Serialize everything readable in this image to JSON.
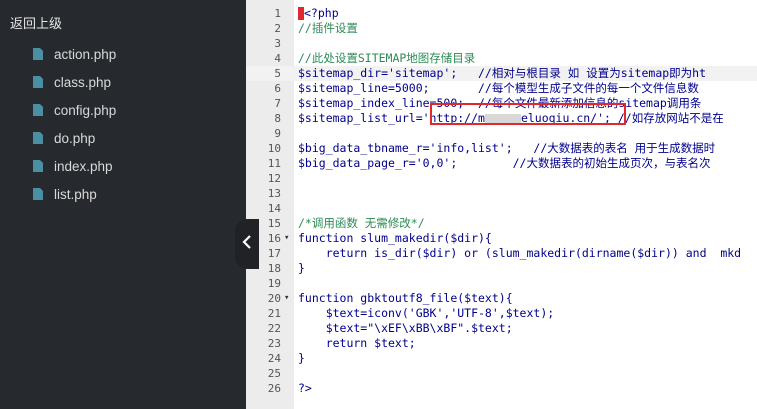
{
  "sidebar": {
    "back_label": "返回上级",
    "files": [
      {
        "name": "action.php"
      },
      {
        "name": "class.php"
      },
      {
        "name": "config.php"
      },
      {
        "name": "do.php"
      },
      {
        "name": "index.php"
      },
      {
        "name": "list.php"
      }
    ]
  },
  "editor": {
    "lines": [
      {
        "n": "1",
        "text": "<?php"
      },
      {
        "n": "2",
        "text": "//插件设置"
      },
      {
        "n": "3",
        "text": ""
      },
      {
        "n": "4",
        "text": "//此处设置SITEMAP地图存储目录"
      },
      {
        "n": "5",
        "text": "$sitemap_dir='sitemap';   //相对与根目录 如 设置为sitemap即为ht"
      },
      {
        "n": "6",
        "text": "$sitemap_line=5000;       //每个模型生成子文件的每一个文件信息数"
      },
      {
        "n": "7",
        "text": "$sitemap_index_line=500;  //每个文件最新添加信息的sitemap调用条"
      },
      {
        "n": "8a",
        "text": "$sitemap_list_url='http://m"
      },
      {
        "n": "8b",
        "text": "eluoqiu.cn/'; //如存放网站不是在"
      },
      {
        "n": "9",
        "text": ""
      },
      {
        "n": "10",
        "text": "$big_data_tbname_r='info,list';   //大数据表的表名 用于生成数据时"
      },
      {
        "n": "11",
        "text": "$big_data_page_r='0,0';        //大数据表的初始生成页次，与表名次"
      },
      {
        "n": "12",
        "text": ""
      },
      {
        "n": "13",
        "text": ""
      },
      {
        "n": "14",
        "text": ""
      },
      {
        "n": "15",
        "text": "/*调用函数 无需修改*/"
      },
      {
        "n": "16",
        "text": "function slum_makedir($dir){"
      },
      {
        "n": "17",
        "text": "    return is_dir($dir) or (slum_makedir(dirname($dir)) and  mkd"
      },
      {
        "n": "18",
        "text": "}"
      },
      {
        "n": "19",
        "text": ""
      },
      {
        "n": "20",
        "text": "function gbktoutf8_file($text){"
      },
      {
        "n": "21",
        "text": "    $text=iconv('GBK','UTF-8',$text);"
      },
      {
        "n": "22",
        "text": "    $text=\"\\xEF\\xBB\\xBF\".$text;"
      },
      {
        "n": "23",
        "text": "    return $text;"
      },
      {
        "n": "24",
        "text": "}"
      },
      {
        "n": "25",
        "text": ""
      },
      {
        "n": "26",
        "text": "?>"
      }
    ]
  },
  "icons": {
    "file": "file-icon",
    "collapse": "chevron-left-icon"
  },
  "colors": {
    "sidebar_bg": "#26292e",
    "highlight_box": "#e0282d",
    "gutter_bg": "#ececec"
  }
}
